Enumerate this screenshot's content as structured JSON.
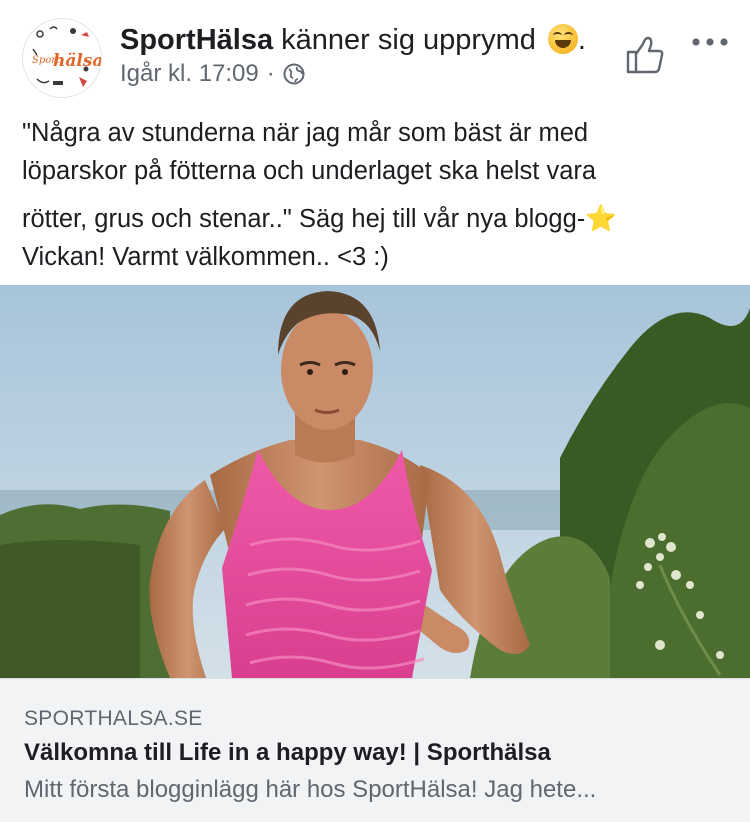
{
  "post": {
    "page_name": "SportHälsa",
    "feeling_text": " känner sig upprymd ",
    "feeling_suffix": ".",
    "avatar_logo_text": "Sporthälsa",
    "timestamp": "Igår kl. 17:09",
    "separator": "·",
    "privacy_icon": "globe-icon",
    "feeling_icon": "grinning-squinting-emoji",
    "actions": {
      "like_icon": "thumbs-up-icon",
      "more_icon": "more-dots-icon"
    },
    "text_lines": [
      "\"Några av stunderna när jag mår som bäst är med",
      "löparskor på fötterna och underlaget ska helst vara",
      "rötter, grus och stenar..\" Säg hej till vår nya blogg-⭐",
      "Vickan! Varmt välkommen.. <3 :)"
    ]
  },
  "link_preview": {
    "domain": "SPORTHALSA.SE",
    "title": "Välkomna till Life in a happy way! | Sporthälsa",
    "description": "Mitt första blogginlägg här hos SportHälsa! Jag hete..."
  },
  "colors": {
    "text_primary": "#1c1e21",
    "text_secondary": "#606770",
    "card_bg": "#f2f3f5",
    "tank_top": "#e5479a",
    "logo_orange": "#e0662a"
  }
}
